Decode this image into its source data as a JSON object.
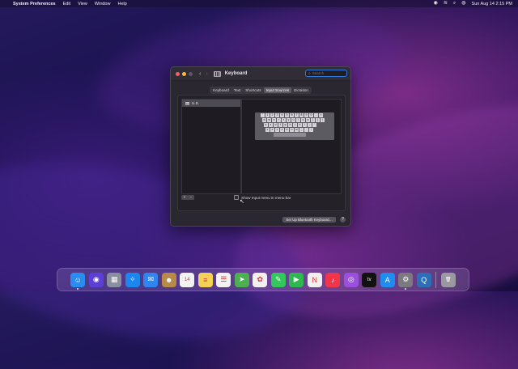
{
  "menubar": {
    "app_name": "System Preferences",
    "items": [
      "Edit",
      "View",
      "Window",
      "Help"
    ],
    "datetime": "Sun Aug 14  2:15 PM",
    "status_icons": [
      "control-center-icon",
      "wifi-icon",
      "search-icon",
      "siri-icon"
    ]
  },
  "window": {
    "title": "Keyboard",
    "search_placeholder": "Search",
    "tabs": [
      {
        "label": "Keyboard",
        "active": false
      },
      {
        "label": "Text",
        "active": false
      },
      {
        "label": "Shortcuts",
        "active": false
      },
      {
        "label": "Input Sources",
        "active": true
      },
      {
        "label": "Dictation",
        "active": false
      }
    ],
    "input_sources": [
      {
        "label": "U.S."
      }
    ],
    "add_label": "+",
    "remove_label": "−",
    "show_menu_label": "Show Input menu in menu bar",
    "show_menu_checked": false,
    "bluetooth_button": "Set Up Bluetooth Keyboard…",
    "help_label": "?",
    "keyboard_rows": [
      [
        "`",
        "1",
        "2",
        "3",
        "4",
        "5",
        "6",
        "7",
        "8",
        "9",
        "0",
        "-",
        "="
      ],
      [
        "q",
        "w",
        "e",
        "r",
        "t",
        "y",
        "u",
        "i",
        "o",
        "p",
        "[",
        "]",
        "\\"
      ],
      [
        "a",
        "s",
        "d",
        "f",
        "g",
        "h",
        "j",
        "k",
        "l",
        ";",
        "'"
      ],
      [
        "z",
        "x",
        "c",
        "v",
        "b",
        "n",
        "m",
        ",",
        ".",
        "/"
      ]
    ]
  },
  "dock": {
    "apps": [
      {
        "name": "finder-icon",
        "color": "#2b8cf0",
        "glyph": "☺",
        "running": true
      },
      {
        "name": "siri-icon",
        "color": "#5b3fd6",
        "glyph": "◉",
        "running": false
      },
      {
        "name": "launchpad-icon",
        "color": "#8a8fa0",
        "glyph": "▦",
        "running": false
      },
      {
        "name": "safari-icon",
        "color": "#1c86ee",
        "glyph": "✧",
        "running": false
      },
      {
        "name": "mail-icon",
        "color": "#2f86f0",
        "glyph": "✉",
        "running": false
      },
      {
        "name": "contacts-icon",
        "color": "#b88a4a",
        "glyph": "☻",
        "running": false
      },
      {
        "name": "calendar-icon",
        "color": "#f2f2f2",
        "glyph": "14",
        "running": false
      },
      {
        "name": "notes-icon",
        "color": "#f4d258",
        "glyph": "≡",
        "running": false
      },
      {
        "name": "reminders-icon",
        "color": "#f2f2f2",
        "glyph": "☰",
        "running": false
      },
      {
        "name": "maps-icon",
        "color": "#4caf50",
        "glyph": "➤",
        "running": false
      },
      {
        "name": "photos-icon",
        "color": "#f0f0f0",
        "glyph": "✿",
        "running": false
      },
      {
        "name": "messages-icon",
        "color": "#34c759",
        "glyph": "✎",
        "running": false
      },
      {
        "name": "facetime-icon",
        "color": "#2fb84f",
        "glyph": "▶",
        "running": false
      },
      {
        "name": "news-icon",
        "color": "#f0f0f0",
        "glyph": "N",
        "running": false
      },
      {
        "name": "music-icon",
        "color": "#f2364a",
        "glyph": "♪",
        "running": false
      },
      {
        "name": "podcasts-icon",
        "color": "#9b4fe0",
        "glyph": "◎",
        "running": false
      },
      {
        "name": "tv-icon",
        "color": "#111111",
        "glyph": "tv",
        "running": false
      },
      {
        "name": "app-store-icon",
        "color": "#1f8df0",
        "glyph": "A",
        "running": false
      },
      {
        "name": "system-preferences-icon",
        "color": "#7a7a80",
        "glyph": "⚙",
        "running": true
      },
      {
        "name": "quicktime-icon",
        "color": "#2a6fb8",
        "glyph": "Q",
        "running": false
      },
      {
        "name": "trash-icon",
        "color": "#9a98a0",
        "glyph": "🗑",
        "running": false
      }
    ]
  }
}
